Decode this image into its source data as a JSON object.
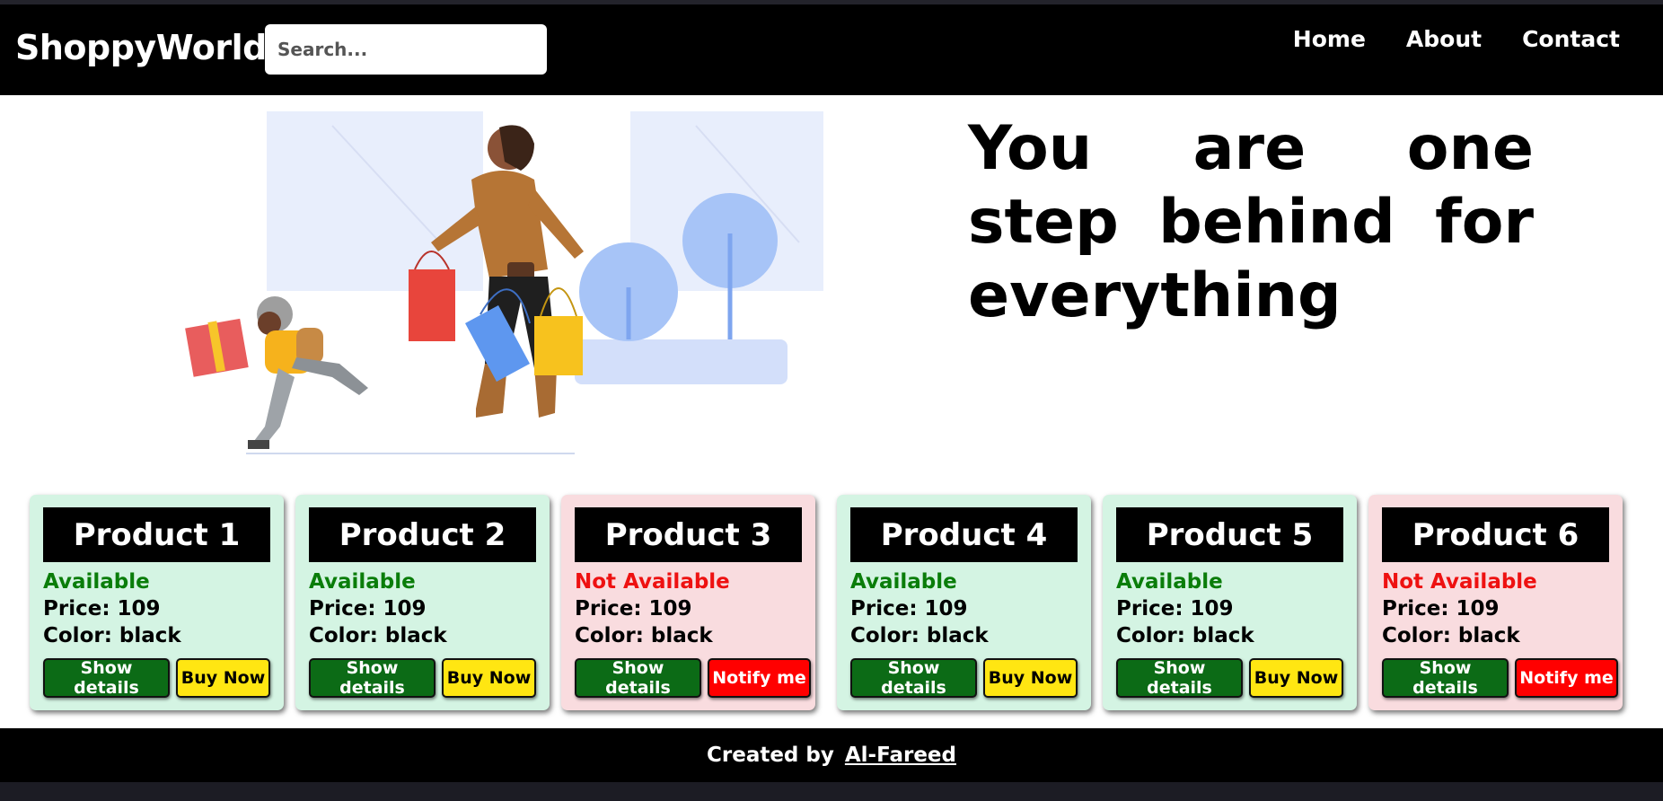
{
  "header": {
    "brand": "ShoppyWorld",
    "search_placeholder": "Search...",
    "nav": [
      {
        "label": "Home"
      },
      {
        "label": "About"
      },
      {
        "label": "Contact"
      }
    ]
  },
  "hero": {
    "headline": "You are one step behind for everything"
  },
  "products": [
    {
      "name": "Product 1",
      "status": "Available",
      "price": "Price: 109",
      "color": "Color: black",
      "details_label": "Show details",
      "action_label": "Buy Now"
    },
    {
      "name": "Product 2",
      "status": "Available",
      "price": "Price: 109",
      "color": "Color: black",
      "details_label": "Show details",
      "action_label": "Buy Now"
    },
    {
      "name": "Product 3",
      "status": "Not Available",
      "price": "Price: 109",
      "color": "Color: black",
      "details_label": "Show details",
      "action_label": "Notify me"
    },
    {
      "name": "Product 4",
      "status": "Available",
      "price": "Price: 109",
      "color": "Color: black",
      "details_label": "Show details",
      "action_label": "Buy Now"
    },
    {
      "name": "Product 5",
      "status": "Available",
      "price": "Price: 109",
      "color": "Color: black",
      "details_label": "Show details",
      "action_label": "Buy Now"
    },
    {
      "name": "Product 6",
      "status": "Not Available",
      "price": "Price: 109",
      "color": "Color: black",
      "details_label": "Show details",
      "action_label": "Notify me"
    }
  ],
  "footer": {
    "prefix": "Created by",
    "author": "Al-Fareed"
  },
  "colors": {
    "available_text": "#0a7d0a",
    "unavailable_text": "#ee1111",
    "available_card": "#d4f4e3",
    "unavailable_card": "#f9dcdf",
    "details_button": "#0c6b16",
    "buy_button": "#ffe612",
    "notify_button": "#ff0000"
  }
}
